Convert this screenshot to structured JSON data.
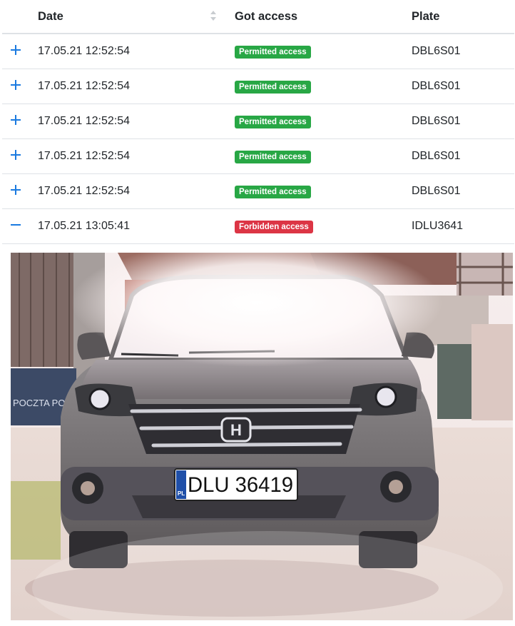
{
  "table": {
    "headers": {
      "date": "Date",
      "access": "Got access",
      "plate": "Plate"
    },
    "rows": [
      {
        "expanded": false,
        "date": "17.05.21 12:52:54",
        "access": "Permitted access",
        "status": "permitted",
        "plate": "DBL6S01"
      },
      {
        "expanded": false,
        "date": "17.05.21 12:52:54",
        "access": "Permitted access",
        "status": "permitted",
        "plate": "DBL6S01"
      },
      {
        "expanded": false,
        "date": "17.05.21 12:52:54",
        "access": "Permitted access",
        "status": "permitted",
        "plate": "DBL6S01"
      },
      {
        "expanded": false,
        "date": "17.05.21 12:52:54",
        "access": "Permitted access",
        "status": "permitted",
        "plate": "DBL6S01"
      },
      {
        "expanded": false,
        "date": "17.05.21 12:52:54",
        "access": "Permitted access",
        "status": "permitted",
        "plate": "DBL6S01"
      },
      {
        "expanded": true,
        "date": "17.05.21 13:05:41",
        "access": "Forbidden access",
        "status": "forbidden",
        "plate": "IDLU3641"
      }
    ]
  },
  "detail_photo": {
    "plate_text": "DLU 36419",
    "plate_country": "PL",
    "mailbox_text": "POCZTA POCZT"
  },
  "colors": {
    "permitted": "#28a745",
    "forbidden": "#dc3545",
    "toggle": "#1a7ae0"
  },
  "icons": {
    "expand": "plus-icon",
    "collapse": "minus-icon",
    "sort": "sort-icon"
  }
}
